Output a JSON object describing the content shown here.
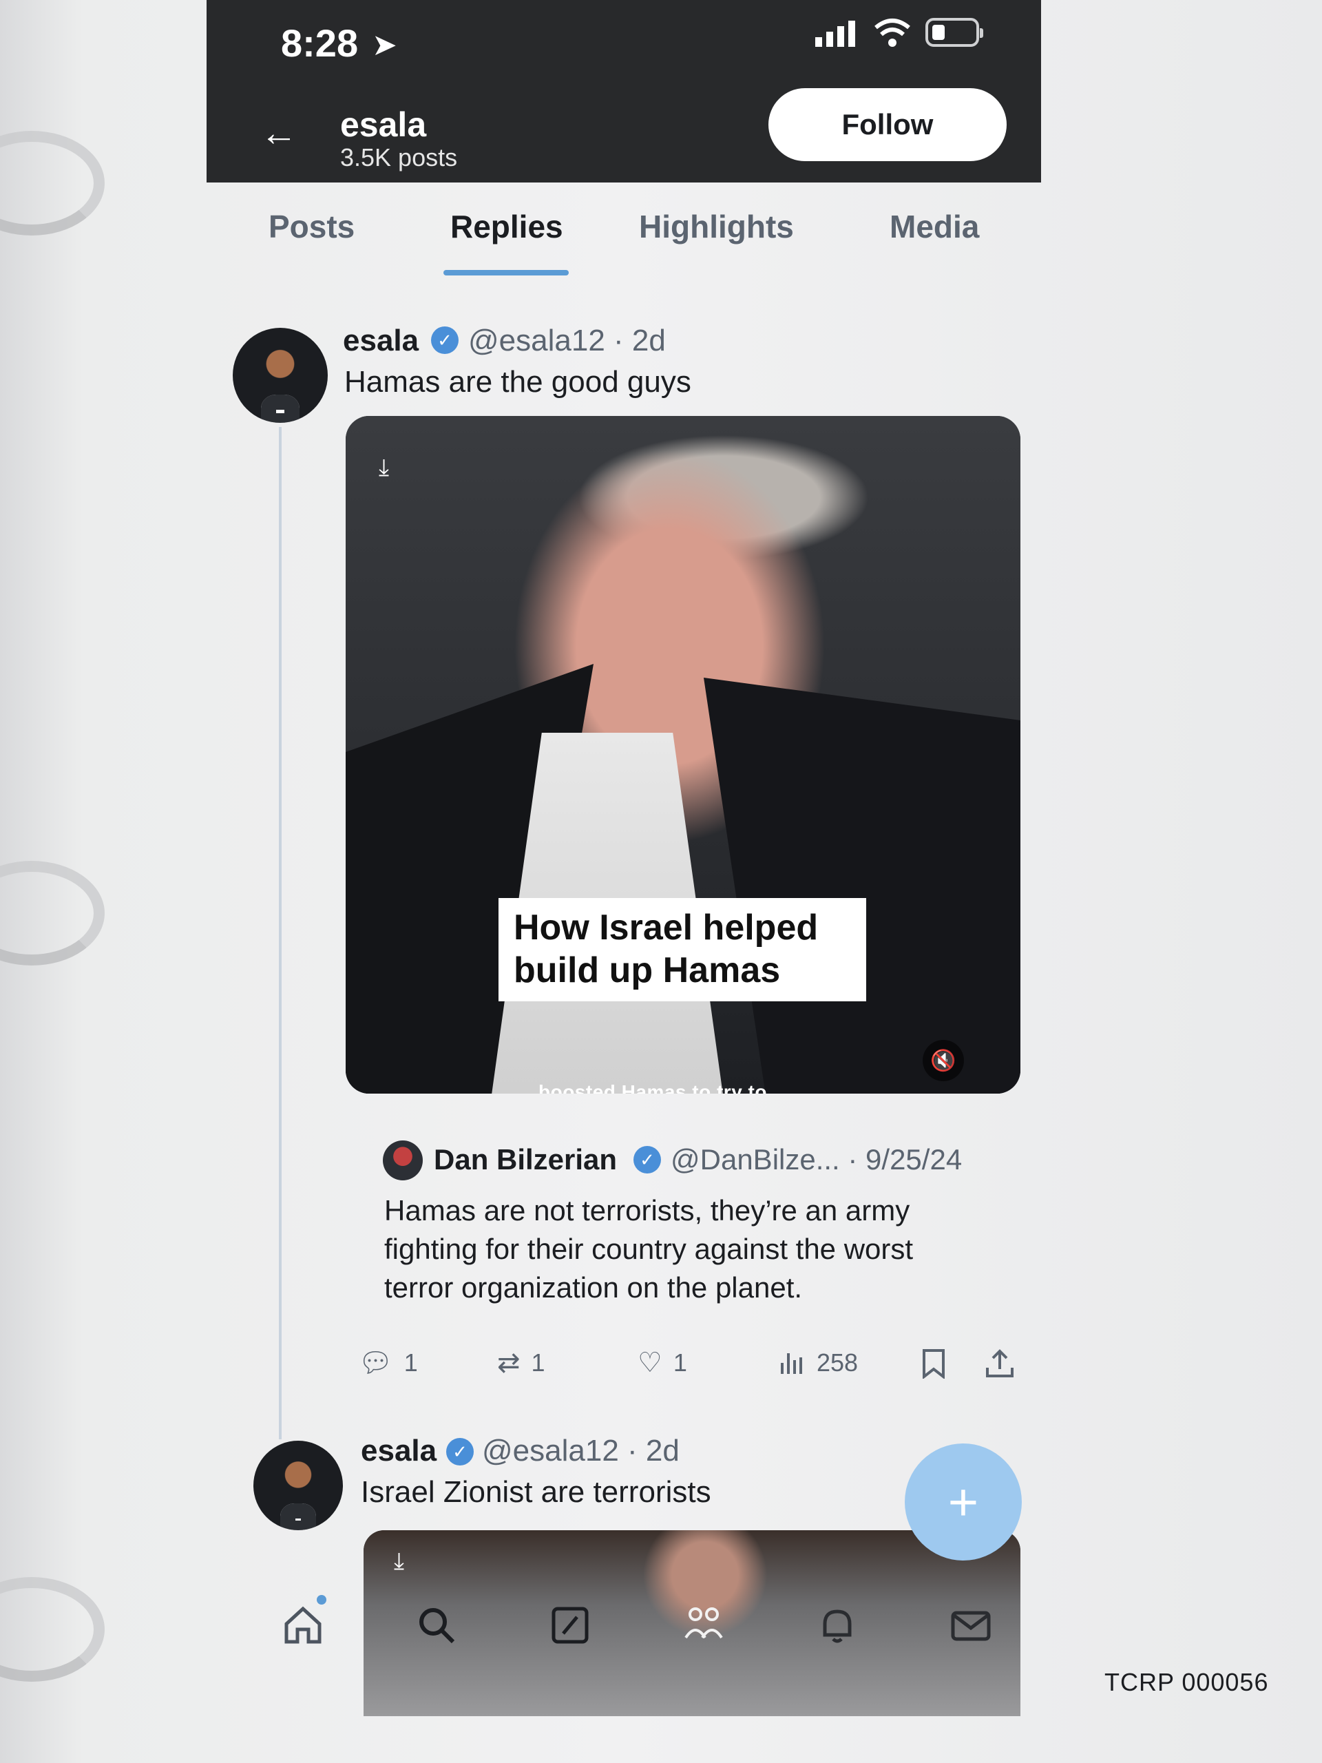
{
  "status_bar": {
    "time": "8:28"
  },
  "header": {
    "back_icon": "arrow-left-icon",
    "name": "esala",
    "posts": "3.5K posts",
    "follow_label": "Follow"
  },
  "tabs": [
    {
      "label": "Posts",
      "active": false
    },
    {
      "label": "Replies",
      "active": true
    },
    {
      "label": "Highlights",
      "active": false
    },
    {
      "label": "Media",
      "active": false
    }
  ],
  "posts": [
    {
      "author": "esala",
      "verified": true,
      "handle_date": "@esala12 · 2d",
      "text": "Hamas are the good guys",
      "media": {
        "overlay_lines": [
          "How Israel helped",
          "build up Hamas"
        ],
        "caption": "boosted Hamas to try to"
      },
      "quote": {
        "author": "Dan Bilzerian",
        "verified": true,
        "handle_date": "@DanBilze... · 9/25/24",
        "text_lines": [
          "Hamas are not terrorists, they’re an army",
          "fighting for their country against the worst",
          "terror organization on the planet."
        ]
      },
      "actions": {
        "replies": "1",
        "reposts": "1",
        "likes": "1",
        "views": "258"
      }
    },
    {
      "author": "esala",
      "verified": true,
      "handle_date": "@esala12 · 2d",
      "text": "Israel Zionist are terrorists"
    }
  ],
  "bottom_nav": [
    "home-icon",
    "search-icon",
    "compose-icon",
    "communities-icon",
    "notifications-icon",
    "messages-icon"
  ],
  "bates_number": "TCRP 000056",
  "colors": {
    "accent": "#5b9bd5",
    "verified": "#4a8fd8",
    "fab": "#9ec9ef",
    "header_bg": "#28292b"
  }
}
